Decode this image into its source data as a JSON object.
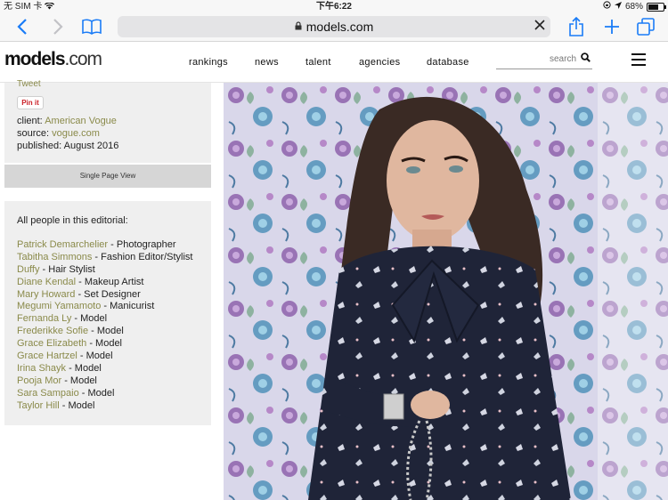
{
  "status_bar": {
    "carrier": "无 SIM 卡",
    "time": "下午6:22",
    "battery": "68%",
    "battery_level": 0.68
  },
  "browser": {
    "url": "models.com",
    "back_icon": "chevron-left-icon",
    "forward_icon": "chevron-right-icon",
    "bookmarks_icon": "book-icon",
    "clear_icon": "close-icon",
    "share_icon": "share-icon",
    "add_icon": "plus-icon",
    "tabs_icon": "tabs-icon"
  },
  "site": {
    "logo_main": "models",
    "logo_tld": ".com",
    "nav": [
      "rankings",
      "news",
      "talent",
      "agencies",
      "database"
    ],
    "search_placeholder": "search"
  },
  "editorial": {
    "tweet": "Tweet",
    "pin_it": "Pin it",
    "client_label": "client:",
    "client": "American Vogue",
    "source_label": "source:",
    "source": "vogue.com",
    "published_label": "published:",
    "published": "August 2016",
    "single_page_view": "Single Page View"
  },
  "people": {
    "heading": "All people in this editorial:",
    "list": [
      {
        "name": "Patrick Demarchelier",
        "role": " - Photographer"
      },
      {
        "name": "Tabitha Simmons",
        "role": " - Fashion Editor/Stylist"
      },
      {
        "name": "Duffy",
        "role": " - Hair Stylist"
      },
      {
        "name": "Diane Kendal",
        "role": " - Makeup Artist"
      },
      {
        "name": "Mary Howard",
        "role": " - Set Designer"
      },
      {
        "name": "Megumi Yamamoto",
        "role": " - Manicurist"
      },
      {
        "name": "Fernanda Ly",
        "role": " - Model"
      },
      {
        "name": "Frederikke Sofie",
        "role": " - Model"
      },
      {
        "name": "Grace Elizabeth",
        "role": " - Model"
      },
      {
        "name": "Grace Hartzel",
        "role": " - Model"
      },
      {
        "name": "Irina Shayk",
        "role": " - Model"
      },
      {
        "name": "Pooja Mor",
        "role": " - Model"
      },
      {
        "name": "Sara Sampaio",
        "role": " - Model"
      },
      {
        "name": "Taylor Hill",
        "role": " - Model"
      }
    ]
  },
  "colors": {
    "ios_blue": "#1a7cf7",
    "link_olive": "#8a8a4a",
    "panel_bg": "#efefef"
  }
}
